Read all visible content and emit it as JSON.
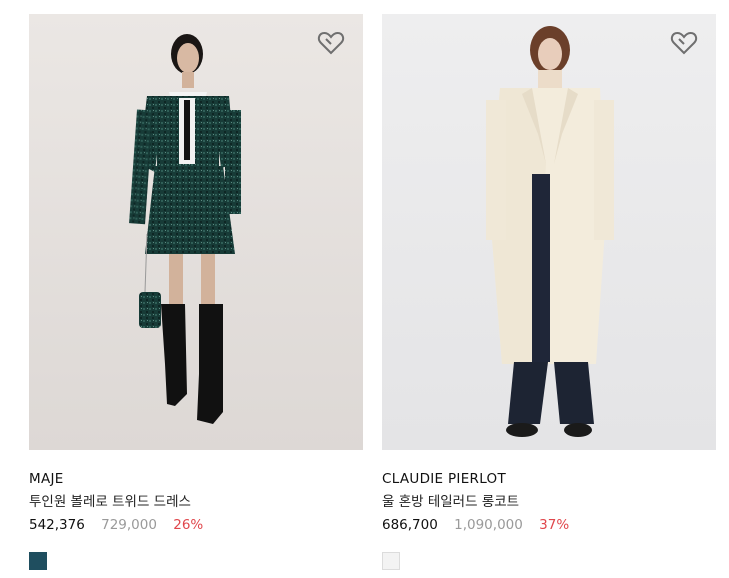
{
  "products": [
    {
      "brand": "MAJE",
      "name": "투인원 볼레로 트위드 드레스",
      "sale_price": "542,376",
      "original_price": "729,000",
      "discount": "26%",
      "swatch_color": "#1f4e5f",
      "photo_bg": "#e6e2df",
      "wishlist_icon": "heart-outline-icon"
    },
    {
      "brand": "CLAUDIE PIERLOT",
      "name": "울 혼방 테일러드 롱코트",
      "sale_price": "686,700",
      "original_price": "1,090,000",
      "discount": "37%",
      "swatch_color": "#f3f3f3",
      "photo_bg": "#ebebec",
      "wishlist_icon": "heart-outline-icon"
    }
  ]
}
